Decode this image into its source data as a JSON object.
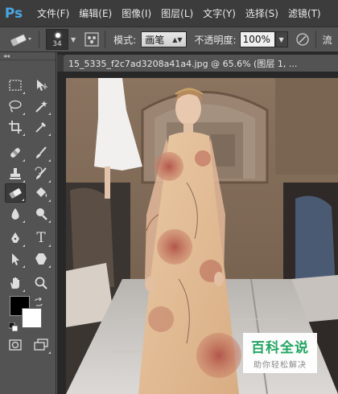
{
  "app": {
    "logo": "Ps",
    "brand_color": "#4aa7e4"
  },
  "menubar": {
    "items": [
      {
        "label": "文件(F)"
      },
      {
        "label": "编辑(E)"
      },
      {
        "label": "图像(I)"
      },
      {
        "label": "图层(L)"
      },
      {
        "label": "文字(Y)"
      },
      {
        "label": "选择(S)"
      },
      {
        "label": "滤镜(T)"
      }
    ]
  },
  "options_bar": {
    "tool_icon": "eraser-icon",
    "brush_size": "34",
    "mode_label": "模式:",
    "mode_value": "画笔",
    "opacity_label": "不透明度:",
    "opacity_value": "100%",
    "overflow_label": "流"
  },
  "toolbox": {
    "tools": [
      {
        "name": "marquee-tool",
        "icon": "marquee-icon"
      },
      {
        "name": "move-tool",
        "icon": "move-icon"
      },
      {
        "name": "lasso-tool",
        "icon": "lasso-icon"
      },
      {
        "name": "magic-wand-tool",
        "icon": "magic-wand-icon"
      },
      {
        "name": "crop-tool",
        "icon": "crop-icon"
      },
      {
        "name": "eyedropper-tool",
        "icon": "eyedropper-icon"
      },
      {
        "name": "healing-tool",
        "icon": "healing-icon"
      },
      {
        "name": "brush-tool",
        "icon": "brush-icon"
      },
      {
        "name": "stamp-tool",
        "icon": "stamp-icon"
      },
      {
        "name": "history-brush-tool",
        "icon": "history-brush-icon"
      },
      {
        "name": "eraser-tool",
        "icon": "eraser-icon"
      },
      {
        "name": "paint-bucket-tool",
        "icon": "paint-bucket-icon"
      },
      {
        "name": "blur-tool",
        "icon": "blur-icon"
      },
      {
        "name": "dodge-tool",
        "icon": "dodge-icon"
      },
      {
        "name": "pen-tool",
        "icon": "pen-icon"
      },
      {
        "name": "type-tool",
        "icon": "type-icon"
      },
      {
        "name": "path-select-tool",
        "icon": "path-select-icon"
      },
      {
        "name": "shape-tool",
        "icon": "shape-icon"
      },
      {
        "name": "hand-tool",
        "icon": "hand-icon"
      },
      {
        "name": "zoom-tool",
        "icon": "zoom-icon"
      }
    ],
    "type_glyph": "T",
    "foreground_color": "#000000",
    "background_color": "#ffffff"
  },
  "document": {
    "tab_title": "15_5335_f2c7ad3208a41a4.jpg @ 65.6% (图层 1, ..."
  },
  "watermark": {
    "title": "百科全说",
    "subtitle": "助你轻松解决",
    "color": "#24a564"
  }
}
